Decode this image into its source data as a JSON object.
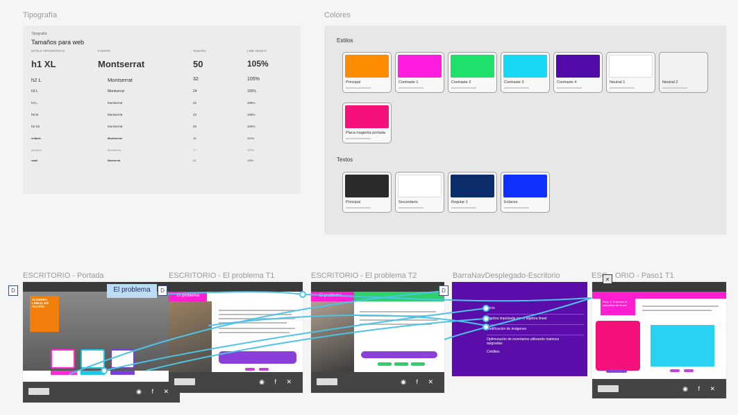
{
  "sections": {
    "typography": "Tipografía",
    "colors": "Colores",
    "frame_portada": "ESCRITORIO - Portada",
    "frame_problema1": "ESCRITORIO - El problema T1",
    "frame_problema2": "ESCRITORIO - El problema T2",
    "frame_barranav": "BarraNavDesplegado-Escritorio",
    "frame_paso1": "ESC",
    "frame_paso1_rest": "ORIO - Paso1 T1"
  },
  "typography": {
    "small_label": "Tipografía",
    "heading": "Tamaños para web",
    "columns": [
      "ESTILO TIPOGRÁFICO",
      "FUENTE",
      "TAMAÑO",
      "LINE HEIGHT"
    ],
    "rows": [
      {
        "style": "h1 XL",
        "font": "Montserrat",
        "size": "50",
        "line": "105%"
      },
      {
        "style": "h2 L",
        "font": "Montserrat",
        "size": "32",
        "line": "105%"
      },
      {
        "style": "h3 L",
        "font": "Montserrat",
        "size": "24",
        "line": "105%"
      },
      {
        "style": "h4 L",
        "font": "Montserrat",
        "size": "22",
        "line": "105%"
      },
      {
        "style": "h5 M",
        "font": "Montserrat",
        "size": "22",
        "line": "105%"
      },
      {
        "style": "h6 XS",
        "font": "Montserrat",
        "size": "20",
        "line": "100%"
      },
      {
        "style": "enfasis",
        "font": "Montserrat",
        "size": "18",
        "line": "100%"
      },
      {
        "style": "parrafos",
        "font": "Montserrat",
        "size": "17",
        "line": "100%"
      },
      {
        "style": "small",
        "font": "Montserrat",
        "size": "14",
        "line": "100%"
      },
      {
        "style": "",
        "font": "",
        "size": "",
        "line": ""
      }
    ]
  },
  "colors": {
    "estilos_label": "Estilos",
    "textos_label": "Textos",
    "estilos": [
      {
        "name": "Principal",
        "color": "#ff8c00"
      },
      {
        "name": "Contraste 1",
        "color": "#ff1ee0"
      },
      {
        "name": "Contraste 2",
        "color": "#1fe06a"
      },
      {
        "name": "Contraste 3",
        "color": "#18d8f4"
      },
      {
        "name": "Contraste 4",
        "color": "#520aa8"
      },
      {
        "name": "Neutral 1",
        "color": "#ffffff"
      },
      {
        "name": "Neutral 2",
        "color": "#f2f2f2"
      },
      {
        "name": "Placa magenta portada",
        "color": "#f5107a"
      }
    ],
    "textos": [
      {
        "name": "Principal",
        "color": "#2b2b2b"
      },
      {
        "name": "Secundario",
        "color": "#ffffff"
      },
      {
        "name": "Regular 1",
        "color": "#0c2d6b"
      },
      {
        "name": "Enlaces",
        "color": "#1030ff"
      }
    ]
  },
  "frames": {
    "portada": {
      "headline": "ÁLGEBRA LINEAL EN ACCIÓN"
    },
    "problema1": {
      "band": "El problema"
    },
    "problema2": {
      "band": "El problema"
    },
    "barranav": {
      "items": [
        "Inicio",
        "Algebra impulsada por el álgebra lineal",
        "Codificación de imágenes",
        "Optimización de inventarios utilizando matrices asignadas",
        "Créditos"
      ]
    },
    "paso1": {
      "band": "Paso 1: Entender la estructura de la red"
    },
    "footer_icons": "◉ f ✕"
  },
  "tags": {
    "problema_tag": "El problema",
    "d_icon": "D",
    "x_icon": "✕"
  }
}
